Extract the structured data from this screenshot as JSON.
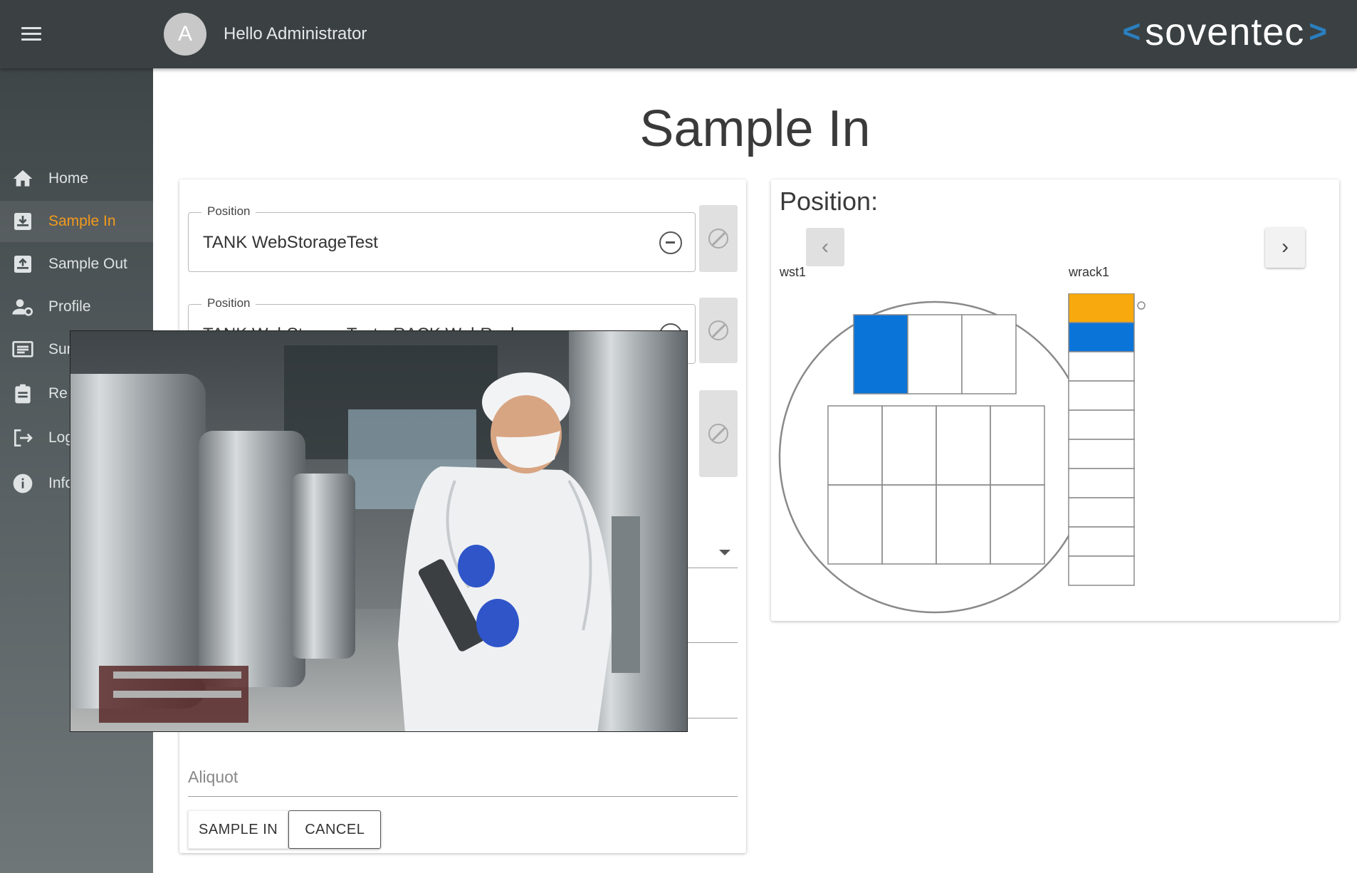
{
  "header": {
    "greeting": "Hello Administrator",
    "avatar_initial": "A",
    "logo_left_bracket": "<",
    "logo_word": "soventec",
    "logo_right_bracket": ">"
  },
  "sidebar": {
    "items": [
      {
        "label": "Home",
        "icon": "home-icon",
        "active": false
      },
      {
        "label": "Sample In",
        "icon": "inbox-in-icon",
        "active": true
      },
      {
        "label": "Sample Out",
        "icon": "inbox-out-icon",
        "active": false
      },
      {
        "label": "Profile",
        "icon": "user-gear-icon",
        "active": false
      },
      {
        "label": "Summary",
        "icon": "list-icon",
        "active": false
      },
      {
        "label": "Re",
        "icon": "clipboard-icon",
        "active": false
      },
      {
        "label": "Log",
        "icon": "logout-icon",
        "active": false
      },
      {
        "label": "Info",
        "icon": "info-icon",
        "active": false
      }
    ]
  },
  "page": {
    "title": "Sample In"
  },
  "form": {
    "positions": [
      {
        "legend": "Position",
        "value": "TANK WebStorageTest"
      },
      {
        "legend": "Position",
        "value": "TANK WebStorageTest › RACK WebRack"
      }
    ],
    "aliquot_label": "Aliquot",
    "buttons": {
      "sample_in": "SAMPLE IN",
      "cancel": "CANCEL"
    }
  },
  "position_panel": {
    "title": "Position:",
    "prev": "‹",
    "next": "›",
    "tank_label": "wst1",
    "rack_label": "wrack1",
    "tank_top_row": [
      "selected",
      "empty",
      "empty"
    ],
    "rack_slots": [
      "occupied",
      "selected",
      "empty",
      "empty",
      "empty",
      "empty",
      "empty",
      "empty",
      "empty",
      "empty"
    ]
  },
  "colors": {
    "accent": "#f39a1b",
    "selected": "#0b74d9",
    "occupied": "#f7a90d",
    "header_bg": "#3b4143",
    "logo_bracket": "#2a7fc0"
  }
}
